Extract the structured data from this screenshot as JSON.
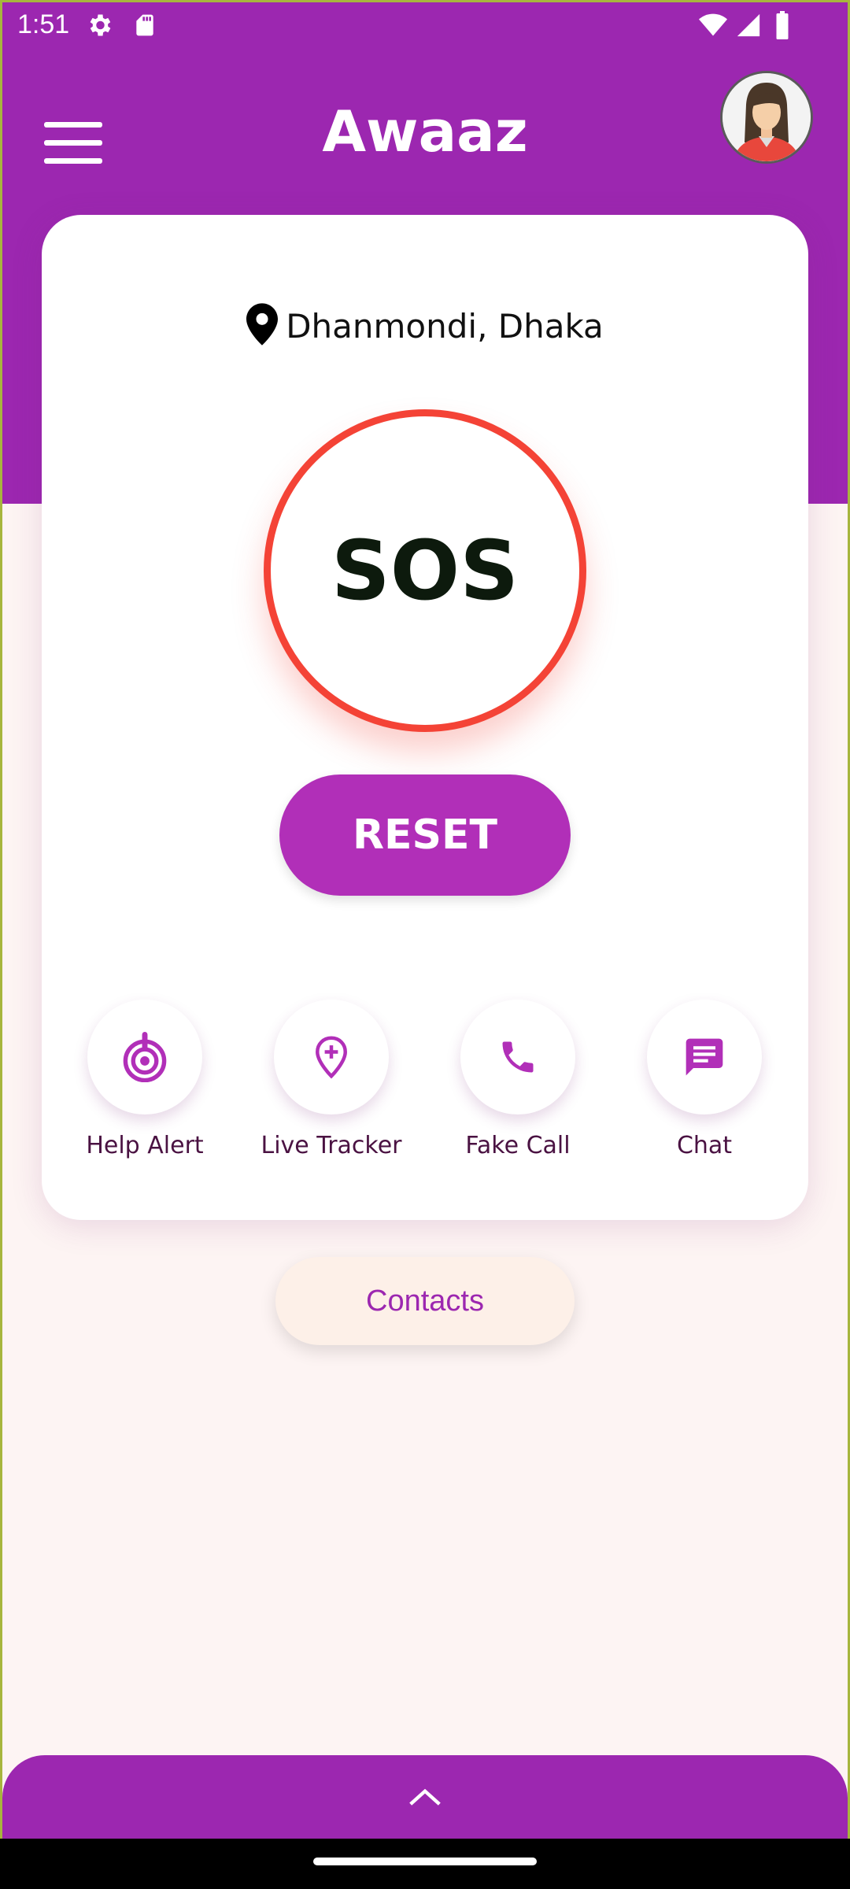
{
  "status_bar": {
    "time": "1:51",
    "icons": [
      "settings-icon",
      "sd-card-icon",
      "wifi-icon",
      "signal-icon",
      "battery-icon"
    ]
  },
  "app_bar": {
    "title": "Awaaz",
    "menu_icon": "hamburger-menu-icon",
    "avatar": "user-avatar"
  },
  "location": {
    "icon": "location-pin-icon",
    "text": "Dhanmondi, Dhaka"
  },
  "sos_label": "SOS",
  "reset_label": "RESET",
  "actions": [
    {
      "icon": "alert-icon",
      "label": "Help Alert"
    },
    {
      "icon": "location-add-icon",
      "label": "Live Tracker"
    },
    {
      "icon": "phone-icon",
      "label": "Fake Call"
    },
    {
      "icon": "chat-icon",
      "label": "Chat"
    }
  ],
  "contacts_label": "Contacts",
  "bottom_sheet": {
    "icon": "chevron-up-icon"
  },
  "colors": {
    "primary": "#9c27b0",
    "button": "#b12fb8",
    "sos_ring": "#f44336",
    "background": "#fdf4f3"
  }
}
